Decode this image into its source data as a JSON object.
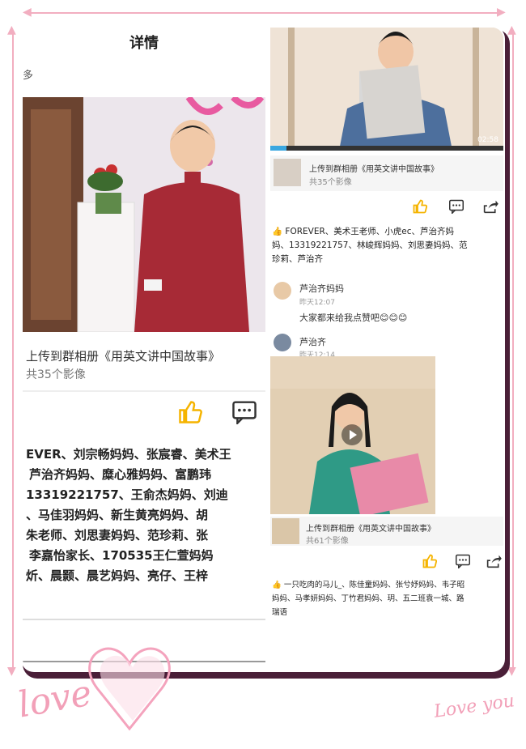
{
  "left_panel": {
    "title": "详情",
    "edge_char": "多",
    "upload_text": "上传到群相册《用英文讲中国故事》",
    "count_text": "共35个影像",
    "likes_lines": [
      "EVER、刘宗畅妈妈、张宸睿、美术王",
      "芦治齐妈妈、糜心雅妈妈、富鹏玮",
      "13319221757、王俞杰妈妈、刘迪",
      "、马佳羽妈妈、新生黄亮妈妈、胡",
      "朱老师、刘思妻妈妈、范珍莉、张",
      "李嘉怡家长、170535王仁萱妈妈",
      "炘、晨颢、晨艺妈妈、亮仔、王梓"
    ],
    "like_icon": "thumbs-up-icon",
    "comment_icon": "comment-icon"
  },
  "right_panel": {
    "video_time": "02:58",
    "post1_upload": "上传到群相册《用英文讲中国故事》",
    "post1_count": "共35个影像",
    "likes_lines": [
      "FOREVER、美术王老师、小虎ec、芦治齐妈",
      "妈、13319221757、林峻辉妈妈、刘思妻妈妈、范",
      "珍莉、芦治齐"
    ],
    "comment1_name": "芦治齐妈妈",
    "comment1_time": "昨天12:07",
    "comment1_text": "大家都来给我点赞吧😊😊😊",
    "comment2_name": "芦治齐",
    "comment2_time": "昨天12:14",
    "post2_upload": "上传到群相册《用英文讲中国故事》",
    "post2_count": "共61个影像",
    "likes2_lines": [
      "一只吃肉的马儿_、陈佳童妈妈、张兮妤妈妈、韦子昭",
      "妈妈、马孝妍妈妈、丁竹君妈妈、玥、五二班袁一城、路",
      "瑞语"
    ]
  },
  "decor": {
    "love_left": "love",
    "love_right": "Love you"
  },
  "colors": {
    "accent_yellow": "#f5b400",
    "frame_pink": "#f2aec0"
  }
}
